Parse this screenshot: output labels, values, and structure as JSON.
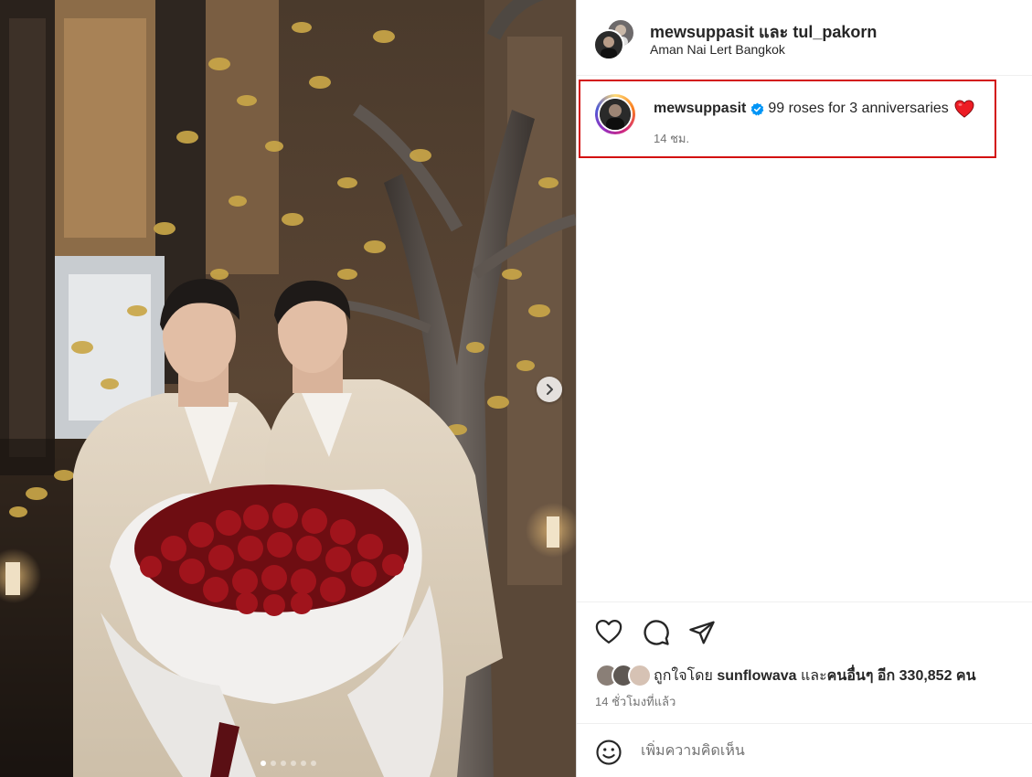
{
  "header": {
    "title": "mewsuppasit และ tul_pakorn",
    "location": "Aman Nai Lert Bangkok"
  },
  "caption": {
    "username": "mewsuppasit",
    "verified": true,
    "text": "99 roses for 3 anniversaries",
    "emoji": "heart",
    "time": "14 ชม."
  },
  "media": {
    "carousel_dots": 6,
    "active_dot": 0,
    "next_icon": "chevron-right-icon"
  },
  "actions": {
    "like_icon": "heart-outline-icon",
    "comment_icon": "comment-bubble-icon",
    "share_icon": "paper-plane-icon"
  },
  "likes": {
    "prefix": "ถูกใจโดย ",
    "user": "sunflowava",
    "middle": " และ",
    "others": "คนอื่นๆ อีก 330,852 คน"
  },
  "post_time": "14 ชั่วโมงที่แล้ว",
  "comment": {
    "placeholder": "เพิ่มความคิดเห็น",
    "emoji_icon": "smiley-icon"
  },
  "colors": {
    "highlight_border": "#d30f0f",
    "verified": "#0095f6",
    "heart": "#ed1c24"
  }
}
